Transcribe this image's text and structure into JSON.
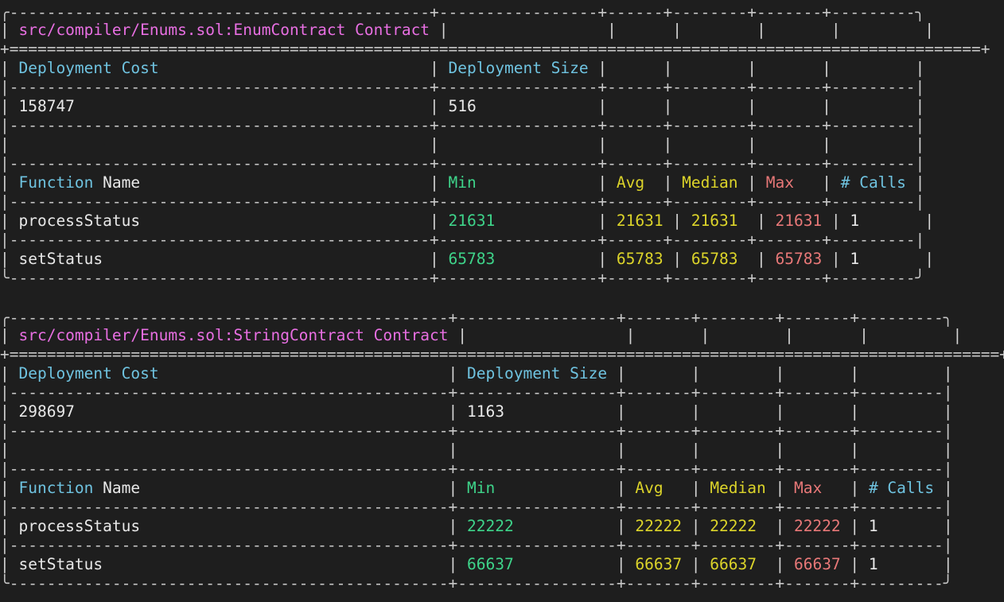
{
  "tables": [
    {
      "title": "src/compiler/Enums.sol:EnumContract Contract",
      "deployment_cost_header": "Deployment Cost",
      "deployment_size_header": "Deployment Size",
      "deployment_cost": "158747",
      "deployment_size": "516",
      "function_header_a": "Function",
      "function_header_b": "Name",
      "min_header": "Min",
      "avg_header": "Avg",
      "median_header": "Median",
      "max_header": "Max",
      "calls_header": "# Calls",
      "rows": [
        {
          "name": "processStatus",
          "min": "21631",
          "avg": "21631",
          "median": "21631",
          "max": "21631",
          "calls": "1"
        },
        {
          "name": "setStatus",
          "min": "65783",
          "avg": "65783",
          "median": "65783",
          "max": "65783",
          "calls": "1"
        }
      ]
    },
    {
      "title": "src/compiler/Enums.sol:StringContract Contract",
      "deployment_cost_header": "Deployment Cost",
      "deployment_size_header": "Deployment Size",
      "deployment_cost": "298697",
      "deployment_size": "1163",
      "function_header_a": "Function",
      "function_header_b": "Name",
      "min_header": "Min",
      "avg_header": "Avg",
      "median_header": "Median",
      "max_header": "Max",
      "calls_header": "# Calls",
      "rows": [
        {
          "name": "processStatus",
          "min": "22222",
          "avg": "22222",
          "median": "22222",
          "max": "22222",
          "calls": "1"
        },
        {
          "name": "setStatus",
          "min": "66637",
          "avg": "66637",
          "median": "66637",
          "max": "66637",
          "calls": "1"
        }
      ]
    }
  ],
  "colors": {
    "background": "#1e1e1e",
    "title": "#e86fe2",
    "header_cyan": "#6fc3e0",
    "min_green": "#3ed48a",
    "avg_median_yellow": "#dcd42a",
    "max_red": "#e87878"
  }
}
